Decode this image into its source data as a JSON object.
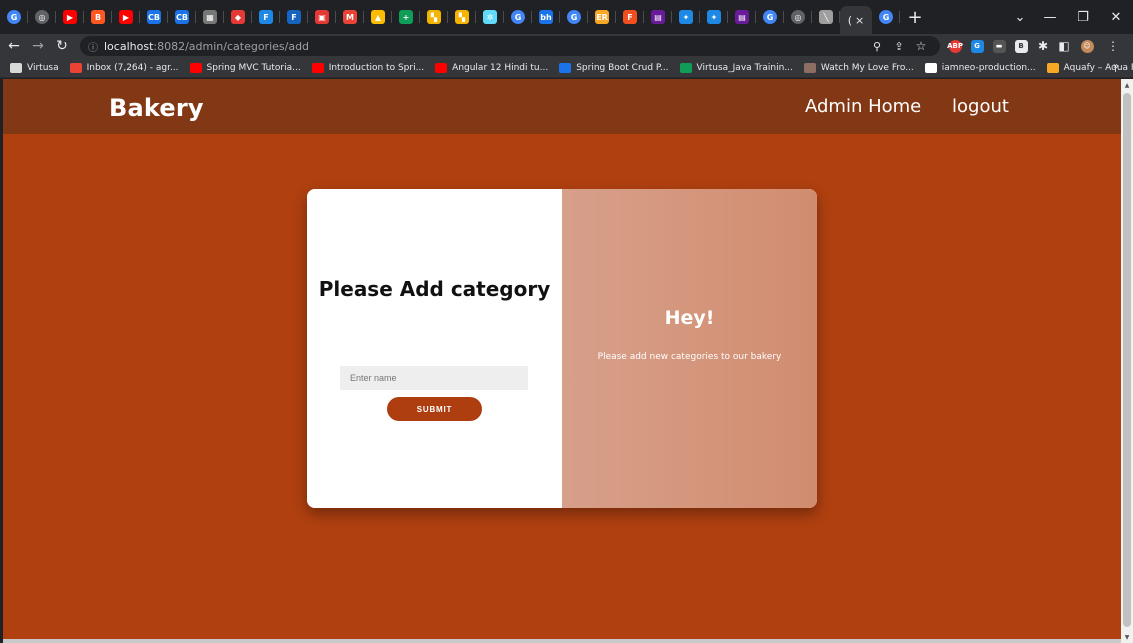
{
  "browser": {
    "tabs": [
      {
        "icon": "google-icon",
        "color": "#4285f4",
        "glyph": "G"
      },
      {
        "icon": "chrome-icon",
        "color": "#5f6368",
        "glyph": "◎"
      },
      {
        "icon": "youtube-icon",
        "color": "#ff0000",
        "glyph": "▶"
      },
      {
        "icon": "blogger-icon",
        "color": "#ff5722",
        "glyph": "B"
      },
      {
        "icon": "youtube-icon",
        "color": "#ff0000",
        "glyph": "▶"
      },
      {
        "icon": "cb-icon",
        "color": "#1a73e8",
        "glyph": "CB"
      },
      {
        "icon": "cb-icon",
        "color": "#1a73e8",
        "glyph": "CB"
      },
      {
        "icon": "qr-icon",
        "color": "#777777",
        "glyph": "▦"
      },
      {
        "icon": "diamond-icon",
        "color": "#e53935",
        "glyph": "◆"
      },
      {
        "icon": "f-icon",
        "color": "#1e88e5",
        "glyph": "F"
      },
      {
        "icon": "f-icon",
        "color": "#1565c0",
        "glyph": "F"
      },
      {
        "icon": "slides-icon",
        "color": "#e53935",
        "glyph": "▣"
      },
      {
        "icon": "gmail-icon",
        "color": "#ea4335",
        "glyph": "M"
      },
      {
        "icon": "drive-icon",
        "color": "#fbbc04",
        "glyph": "▲"
      },
      {
        "icon": "sheets-plus-icon",
        "color": "#0f9d58",
        "glyph": "+"
      },
      {
        "icon": "grid-icon",
        "color": "#f4b400",
        "glyph": "▚"
      },
      {
        "icon": "grid-icon",
        "color": "#f4b400",
        "glyph": "▚"
      },
      {
        "icon": "react-icon",
        "color": "#61dafb",
        "glyph": "✲"
      },
      {
        "icon": "google-icon",
        "color": "#4285f4",
        "glyph": "G"
      },
      {
        "icon": "bh-icon",
        "color": "#1a73e8",
        "glyph": "bh"
      },
      {
        "icon": "google-icon",
        "color": "#4285f4",
        "glyph": "G"
      },
      {
        "icon": "er-icon",
        "color": "#f9a825",
        "glyph": "ER"
      },
      {
        "icon": "figma-icon",
        "color": "#f24e1e",
        "glyph": "F"
      },
      {
        "icon": "code-icon",
        "color": "#6a1b9a",
        "glyph": "▤"
      },
      {
        "icon": "compass-icon",
        "color": "#1e88e5",
        "glyph": "✦"
      },
      {
        "icon": "compass-icon",
        "color": "#1e88e5",
        "glyph": "✦"
      },
      {
        "icon": "code-icon",
        "color": "#6a1b9a",
        "glyph": "▤"
      },
      {
        "icon": "google-icon",
        "color": "#4285f4",
        "glyph": "G"
      },
      {
        "icon": "chrome-icon",
        "color": "#5f6368",
        "glyph": "◎"
      },
      {
        "icon": "pen-icon",
        "color": "#9e9e9e",
        "glyph": "╲"
      }
    ],
    "active_tab_glyph": "(",
    "active_tab_close": "×",
    "new_tab_label": "+",
    "address": {
      "info_glyph": "ⓘ",
      "host": "localhost",
      "path": ":8082/admin/categories/add"
    },
    "bookmarks": [
      {
        "label": "Virtusa",
        "icon": "virtusa-icon",
        "color": "#d8d8d8"
      },
      {
        "label": "Inbox (7,264) - agr...",
        "icon": "gmail-icon",
        "color": "#ea4335"
      },
      {
        "label": "Spring MVC Tutoria...",
        "icon": "youtube-icon",
        "color": "#ff0000"
      },
      {
        "label": "Introduction to Spri...",
        "icon": "youtube-icon",
        "color": "#ff0000"
      },
      {
        "label": "Angular 12 Hindi tu...",
        "icon": "youtube-icon",
        "color": "#ff0000"
      },
      {
        "label": "Spring Boot Crud P...",
        "icon": "bookmark-page-icon",
        "color": "#1a73e8"
      },
      {
        "label": "Virtusa_Java Trainin...",
        "icon": "sheets-plus-icon",
        "color": "#0f9d58"
      },
      {
        "label": "Watch My Love Fro...",
        "icon": "film-icon",
        "color": "#8d6e63"
      },
      {
        "label": "iamneo-production...",
        "icon": "github-icon",
        "color": "#ffffff"
      },
      {
        "label": "Aquafy – Aqua Far...",
        "icon": "aquafy-icon",
        "color": "#f9a825"
      }
    ],
    "bookmarks_more": "»"
  },
  "navbar": {
    "brand": "Bakery",
    "links": [
      "Admin Home",
      "logout"
    ]
  },
  "form": {
    "title": "Please Add category",
    "name_placeholder": "Enter name",
    "name_value": "",
    "submit_label": "SUBMIT"
  },
  "panel": {
    "heading": "Hey!",
    "message": "Please add new categories to our bakery"
  },
  "colors": {
    "page_bg": "#b04010",
    "navbar_bg": "#823815",
    "button_bg": "#ae3d10",
    "panel_gradient_start": "#d7a08a",
    "panel_gradient_end": "#d18c6f"
  }
}
